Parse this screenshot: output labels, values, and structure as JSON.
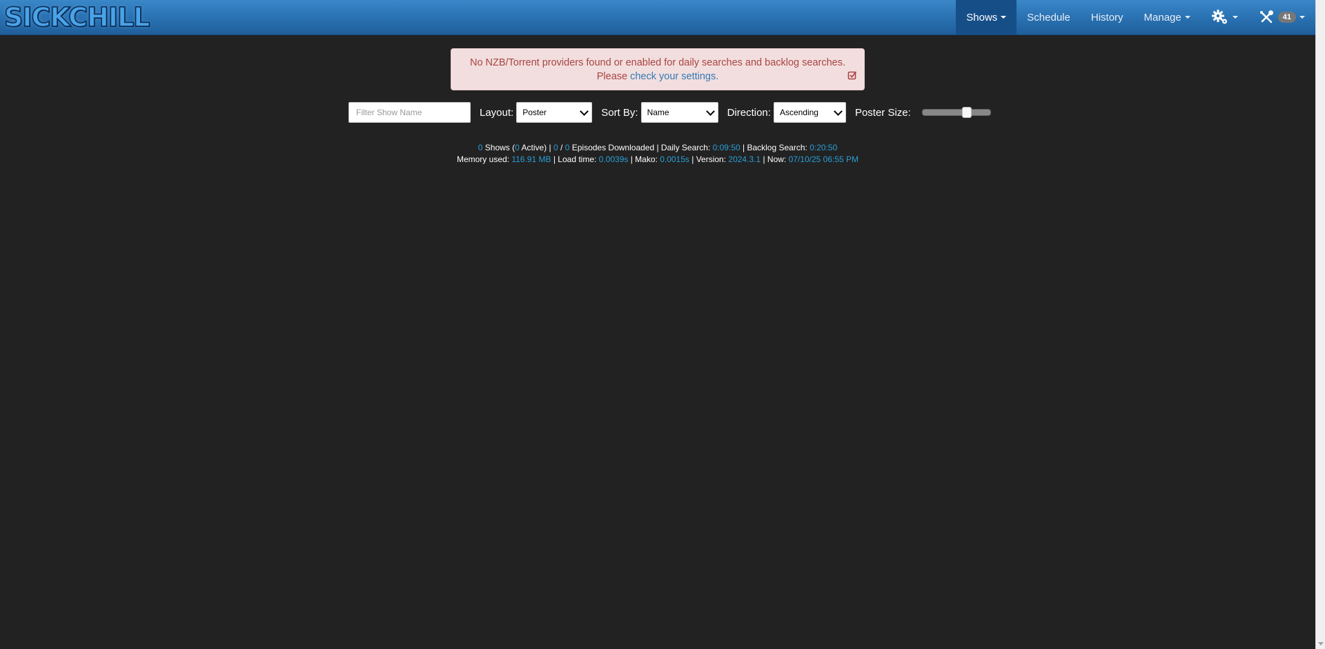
{
  "brand": {
    "logo_text": "SICKCHILL"
  },
  "nav": {
    "shows": "Shows",
    "schedule": "Schedule",
    "history": "History",
    "manage": "Manage",
    "tools_badge": "41"
  },
  "alert": {
    "line1": "No NZB/Torrent providers found or enabled for daily searches and backlog searches.",
    "line2_prefix": "Please",
    "link": "check your settings."
  },
  "controls": {
    "filter_placeholder": "Filter Show Name",
    "layout_label": "Layout:",
    "layout_value": "Poster",
    "sort_label": "Sort By:",
    "sort_value": "Name",
    "direction_label": "Direction:",
    "direction_value": "Ascending",
    "poster_size_label": "Poster Size:",
    "poster_size_level": 0.65
  },
  "stats": {
    "shows_count": "0",
    "shows_label": "Shows (",
    "active_count": "0",
    "active_label": "Active)  |",
    "downloaded": "0",
    "slash": "/",
    "total_episodes": "0",
    "episodes_label": "Episodes Downloaded  | Daily Search:",
    "daily_search": "0:09:50",
    "backlog_label": "| Backlog Search:",
    "backlog_search": "0:20:50",
    "memory_label": "Memory used:",
    "memory": "116.91 MB",
    "load_label": "| Load time:",
    "load_time": "0.0039s",
    "mako_label": "| Mako:",
    "mako": "0.0015s",
    "version_label": "| Version:",
    "version": "2024.3.1",
    "now_label": "| Now:",
    "now": "07/10/25 06:55 PM"
  },
  "colors": {
    "background": "#222222",
    "navbar": "#2b74b5",
    "accent": "#2a9fd6",
    "alert_bg": "#f2dede",
    "alert_text": "#a94442"
  },
  "icons": {
    "config": "gear-icon",
    "tools": "tools-icon",
    "alert_close": "check-square-icon"
  }
}
